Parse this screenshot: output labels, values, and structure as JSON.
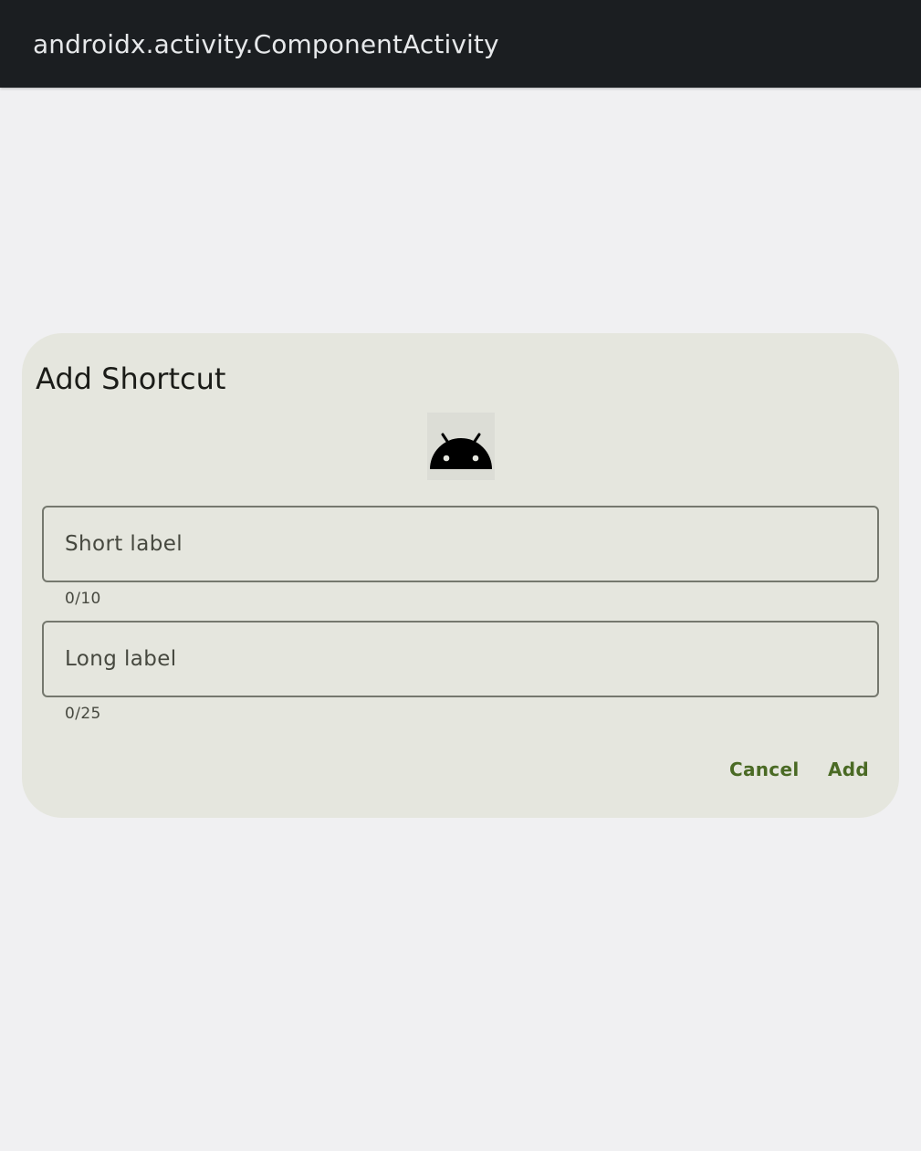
{
  "app_bar": {
    "title": "androidx.activity.ComponentActivity"
  },
  "dialog": {
    "title": "Add Shortcut",
    "icon": "android-icon",
    "short_label": {
      "placeholder": "Short label",
      "value": "",
      "counter": "0/10"
    },
    "long_label": {
      "placeholder": "Long label",
      "value": "",
      "counter": "0/25"
    },
    "cancel_label": "Cancel",
    "add_label": "Add"
  },
  "colors": {
    "app_bar": "#1b1e21",
    "background": "#f0f0f2",
    "dialog_surface": "#e5e6de",
    "accent": "#4a6a24",
    "outline": "#75786e"
  }
}
